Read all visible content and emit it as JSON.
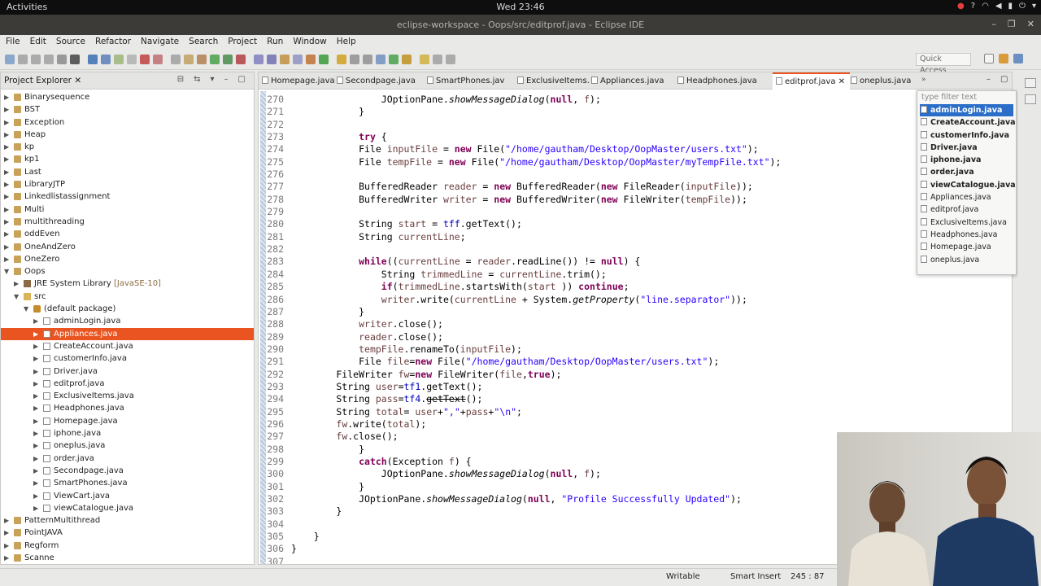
{
  "system": {
    "activities": "Activities",
    "clock": "Wed 23:46"
  },
  "window": {
    "title": "eclipse-workspace - Oops/src/editprof.java - Eclipse IDE"
  },
  "menu": [
    "File",
    "Edit",
    "Source",
    "Refactor",
    "Navigate",
    "Search",
    "Project",
    "Run",
    "Window",
    "Help"
  ],
  "toolbar": {
    "quick_access": "Quick Access"
  },
  "explorer": {
    "title": "Project Explorer",
    "tree": [
      {
        "label": "Binarysequence",
        "level": 0,
        "kind": "proj",
        "expanded": false
      },
      {
        "label": "BST",
        "level": 0,
        "kind": "proj",
        "expanded": false
      },
      {
        "label": "Exception",
        "level": 0,
        "kind": "proj",
        "expanded": false
      },
      {
        "label": "Heap",
        "level": 0,
        "kind": "proj",
        "expanded": false
      },
      {
        "label": "kp",
        "level": 0,
        "kind": "proj",
        "expanded": false
      },
      {
        "label": "kp1",
        "level": 0,
        "kind": "proj",
        "expanded": false
      },
      {
        "label": "Last",
        "level": 0,
        "kind": "proj",
        "expanded": false
      },
      {
        "label": "LibraryJTP",
        "level": 0,
        "kind": "proj",
        "expanded": false
      },
      {
        "label": "Linkedlistassignment",
        "level": 0,
        "kind": "proj",
        "expanded": false
      },
      {
        "label": "Multi",
        "level": 0,
        "kind": "proj",
        "expanded": false
      },
      {
        "label": "multithreading",
        "level": 0,
        "kind": "proj",
        "expanded": false
      },
      {
        "label": "oddEven",
        "level": 0,
        "kind": "proj",
        "expanded": false
      },
      {
        "label": "OneAndZero",
        "level": 0,
        "kind": "proj",
        "expanded": false
      },
      {
        "label": "OneZero",
        "level": 0,
        "kind": "proj",
        "expanded": false
      },
      {
        "label": "Oops",
        "level": 0,
        "kind": "proj",
        "expanded": true
      },
      {
        "label": "JRE System Library",
        "suffix": "[JavaSE-10]",
        "level": 1,
        "kind": "lib",
        "expanded": false
      },
      {
        "label": "src",
        "level": 1,
        "kind": "src",
        "expanded": true
      },
      {
        "label": "(default package)",
        "level": 2,
        "kind": "pkg",
        "expanded": true
      },
      {
        "label": "adminLogin.java",
        "level": 3,
        "kind": "jf",
        "expanded": false
      },
      {
        "label": "Appliances.java",
        "level": 3,
        "kind": "jf",
        "expanded": false,
        "selected": true
      },
      {
        "label": "CreateAccount.java",
        "level": 3,
        "kind": "jf",
        "expanded": false
      },
      {
        "label": "customerInfo.java",
        "level": 3,
        "kind": "jf",
        "expanded": false
      },
      {
        "label": "Driver.java",
        "level": 3,
        "kind": "jf",
        "expanded": false
      },
      {
        "label": "editprof.java",
        "level": 3,
        "kind": "jf",
        "expanded": false
      },
      {
        "label": "ExclusiveItems.java",
        "level": 3,
        "kind": "jf",
        "expanded": false
      },
      {
        "label": "Headphones.java",
        "level": 3,
        "kind": "jf",
        "expanded": false
      },
      {
        "label": "Homepage.java",
        "level": 3,
        "kind": "jf",
        "expanded": false
      },
      {
        "label": "iphone.java",
        "level": 3,
        "kind": "jf",
        "expanded": false
      },
      {
        "label": "oneplus.java",
        "level": 3,
        "kind": "jf",
        "expanded": false
      },
      {
        "label": "order.java",
        "level": 3,
        "kind": "jf",
        "expanded": false
      },
      {
        "label": "Secondpage.java",
        "level": 3,
        "kind": "jf",
        "expanded": false
      },
      {
        "label": "SmartPhones.java",
        "level": 3,
        "kind": "jf",
        "expanded": false
      },
      {
        "label": "ViewCart.java",
        "level": 3,
        "kind": "jf",
        "expanded": false
      },
      {
        "label": "viewCatalogue.java",
        "level": 3,
        "kind": "jf",
        "expanded": false
      },
      {
        "label": "PatternMultithread",
        "level": 0,
        "kind": "proj",
        "expanded": false
      },
      {
        "label": "PointJAVA",
        "level": 0,
        "kind": "proj",
        "expanded": false
      },
      {
        "label": "Regform",
        "level": 0,
        "kind": "proj",
        "expanded": false
      },
      {
        "label": "Scanne",
        "level": 0,
        "kind": "proj",
        "expanded": false
      }
    ]
  },
  "editor": {
    "tabs": [
      {
        "label": "Homepage.java",
        "active": false
      },
      {
        "label": "Secondpage.java",
        "active": false
      },
      {
        "label": "SmartPhones.jav",
        "active": false
      },
      {
        "label": "ExclusiveItems.",
        "active": false
      },
      {
        "label": "Appliances.java",
        "active": false
      },
      {
        "label": "Headphones.java",
        "active": false
      },
      {
        "label": "editprof.java",
        "active": true
      },
      {
        "label": "oneplus.java",
        "active": false
      }
    ],
    "overflow_icon": "chevrons-right-icon",
    "lines": [
      {
        "n": "270",
        "code": "                JOptionPane.showMessageDialog(null, f);"
      },
      {
        "n": "271",
        "code": "            }"
      },
      {
        "n": "272",
        "code": ""
      },
      {
        "n": "273",
        "code": "            try {"
      },
      {
        "n": "274",
        "code": "            File inputFile = new File(\"/home/gautham/Desktop/OopMaster/users.txt\");"
      },
      {
        "n": "275",
        "code": "            File tempFile = new File(\"/home/gautham/Desktop/OopMaster/myTempFile.txt\");"
      },
      {
        "n": "276",
        "code": ""
      },
      {
        "n": "277",
        "code": "            BufferedReader reader = new BufferedReader(new FileReader(inputFile));"
      },
      {
        "n": "278",
        "code": "            BufferedWriter writer = new BufferedWriter(new FileWriter(tempFile));"
      },
      {
        "n": "279",
        "code": ""
      },
      {
        "n": "280",
        "code": "            String start = tff.getText();"
      },
      {
        "n": "281",
        "code": "            String currentLine;"
      },
      {
        "n": "282",
        "code": ""
      },
      {
        "n": "283",
        "code": "            while((currentLine = reader.readLine()) != null) {"
      },
      {
        "n": "284",
        "code": "                String trimmedLine = currentLine.trim();"
      },
      {
        "n": "285",
        "code": "                if(trimmedLine.startsWith(start )) continue;"
      },
      {
        "n": "286",
        "code": "                writer.write(currentLine + System.getProperty(\"line.separator\"));"
      },
      {
        "n": "287",
        "code": "            }"
      },
      {
        "n": "288",
        "code": "            writer.close();"
      },
      {
        "n": "289",
        "code": "            reader.close();"
      },
      {
        "n": "290",
        "code": "            tempFile.renameTo(inputFile);"
      },
      {
        "n": "291",
        "code": "            File file=new File(\"/home/gautham/Desktop/OopMaster/users.txt\");"
      },
      {
        "n": "292",
        "code": "        FileWriter fw=new FileWriter(file,true);"
      },
      {
        "n": "293",
        "code": "        String user=tf1.getText();"
      },
      {
        "n": "294",
        "code": "        String pass=tf4.getText();"
      },
      {
        "n": "295",
        "code": "        String total= user+\",\"+pass+\"\\n\";"
      },
      {
        "n": "296",
        "code": "        fw.write(total);"
      },
      {
        "n": "297",
        "code": "        fw.close();"
      },
      {
        "n": "298",
        "code": "            }"
      },
      {
        "n": "299",
        "code": "            catch(Exception f) {"
      },
      {
        "n": "300",
        "code": "                JOptionPane.showMessageDialog(null, f);"
      },
      {
        "n": "301",
        "code": "            }"
      },
      {
        "n": "302",
        "code": "            JOptionPane.showMessageDialog(null, \"Profile Successfully Updated\");"
      },
      {
        "n": "303",
        "code": "        }"
      },
      {
        "n": "304",
        "code": ""
      },
      {
        "n": "305",
        "code": "    }"
      },
      {
        "n": "306",
        "code": "}"
      },
      {
        "n": "307",
        "code": ""
      }
    ]
  },
  "popup": {
    "filter_placeholder": "type filter text",
    "items": [
      {
        "label": "adminLogin.java",
        "bold": true,
        "selected": true
      },
      {
        "label": "CreateAccount.java",
        "bold": true
      },
      {
        "label": "customerInfo.java",
        "bold": true
      },
      {
        "label": "Driver.java",
        "bold": true
      },
      {
        "label": "iphone.java",
        "bold": true
      },
      {
        "label": "order.java",
        "bold": true
      },
      {
        "label": "viewCatalogue.java",
        "bold": true
      },
      {
        "label": "Appliances.java",
        "bold": false
      },
      {
        "label": "editprof.java",
        "bold": false
      },
      {
        "label": "ExclusiveItems.java",
        "bold": false
      },
      {
        "label": "Headphones.java",
        "bold": false
      },
      {
        "label": "Homepage.java",
        "bold": false
      },
      {
        "label": "oneplus.java",
        "bold": false
      }
    ]
  },
  "status": {
    "mode": "Writable",
    "insert": "Smart Insert",
    "position": "245 : 87"
  },
  "colors": {
    "accent": "#e95420",
    "keyword": "#7f0055",
    "string": "#2a00ff",
    "field": "#0000c0",
    "local": "#6a3e3e",
    "selection_blue": "#2a6ec8"
  }
}
